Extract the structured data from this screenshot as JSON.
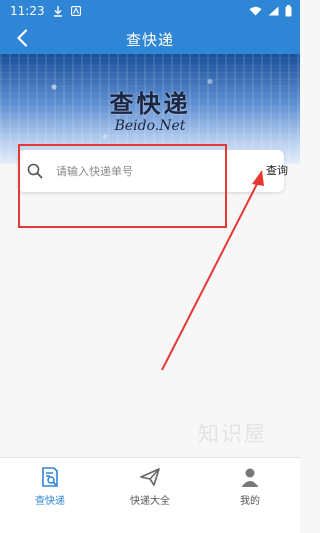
{
  "status_bar": {
    "time": "11:23"
  },
  "header": {
    "title": "查快递"
  },
  "banner": {
    "title": "查快递",
    "subtitle": "Beido.Net"
  },
  "search": {
    "placeholder": "请输入快递单号",
    "value": "",
    "button_label": "查询"
  },
  "watermark": "知识屋",
  "bottom_nav": {
    "items": [
      {
        "label": "查快递",
        "icon": "search-document-icon",
        "active": true
      },
      {
        "label": "快递大全",
        "icon": "paper-plane-icon",
        "active": false
      },
      {
        "label": "我的",
        "icon": "user-icon",
        "active": false
      }
    ]
  },
  "colors": {
    "primary": "#2f86d6",
    "annotation": "#e53935",
    "background": "#f7f7f7"
  }
}
